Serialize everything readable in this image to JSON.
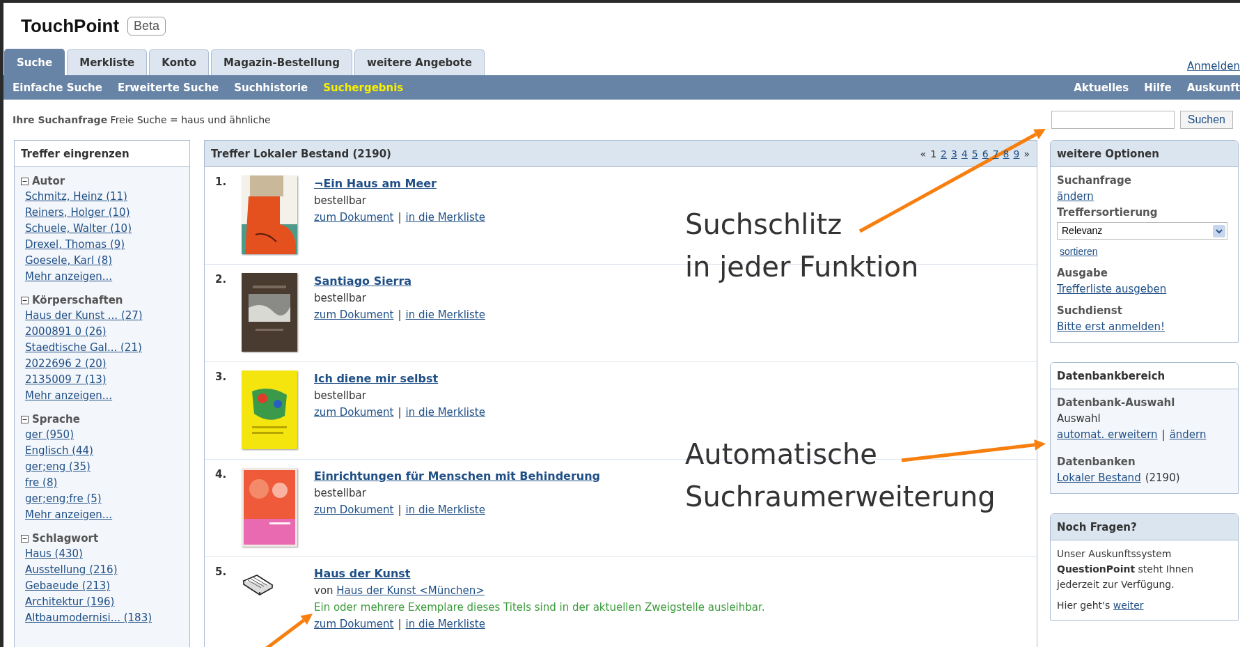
{
  "header": {
    "logo": "TouchPoint",
    "badge": "Beta"
  },
  "tabs": [
    {
      "label": "Suche",
      "selected": true
    },
    {
      "label": "Merkliste",
      "selected": false
    },
    {
      "label": "Konto",
      "selected": false
    },
    {
      "label": "Magazin-Bestellung",
      "selected": false
    },
    {
      "label": "weitere Angebote",
      "selected": false
    }
  ],
  "login_link": "Anmelden",
  "subnav": [
    {
      "label": "Einfache Suche",
      "selected": false
    },
    {
      "label": "Erweiterte Suche",
      "selected": false
    },
    {
      "label": "Suchhistorie",
      "selected": false
    },
    {
      "label": "Suchergebnis",
      "selected": true
    }
  ],
  "service_links": [
    "Aktuelles",
    "Hilfe",
    "Auskunft"
  ],
  "query": "**Ihre Suchanfrage** Freie Suche = haus und ähnliche",
  "search": {
    "button": "Suchen"
  },
  "facets": {
    "title": "Treffer eingrenzen",
    "groups": [
      {
        "label": "Autor",
        "expanded": true,
        "items": [
          "Schmitz, Heinz (11)",
          "Reiners, Holger (10)",
          "Schuele, Walter (10)",
          "Drexel, Thomas (9)",
          "Goesele, Karl (8)"
        ],
        "more": "Mehr anzeigen..."
      },
      {
        "label": "Körperschaften",
        "expanded": true,
        "items": [
          "Haus der Kunst ... (27)",
          "2000891 0 (26)",
          "Staedtische Gal... (21)",
          "2022696 2 (20)",
          "2135009 7 (13)"
        ],
        "more": "Mehr anzeigen..."
      },
      {
        "label": "Sprache",
        "expanded": true,
        "items": [
          "ger (950)",
          "Englisch (44)",
          "ger;eng (35)",
          "fre (8)",
          "ger;eng;fre (5)"
        ],
        "more": "Mehr anzeigen..."
      },
      {
        "label": "Schlagwort",
        "expanded": true,
        "items": [
          "Haus (430)",
          "Ausstellung (216)",
          "Gebaeude (213)",
          "Architektur (196)",
          "Altbaumodernisi... (183)"
        ]
      }
    ]
  },
  "results": {
    "title": "Treffer Lokaler Bestand (2190)",
    "pager": {
      "prev": "«",
      "next": "»",
      "pages": [
        {
          "label": "1",
          "selected": true
        },
        {
          "label": "2",
          "selected": false
        },
        {
          "label": "3",
          "selected": false
        },
        {
          "label": "4",
          "selected": false
        },
        {
          "label": "5",
          "selected": false
        },
        {
          "label": "6",
          "selected": false
        },
        {
          "label": "7",
          "selected": false
        },
        {
          "label": "8",
          "selected": false
        },
        {
          "label": "9",
          "selected": false
        }
      ]
    },
    "items": [
      {
        "number": "1.",
        "kind": "picture",
        "title": "¬Ein Haus am Meer",
        "status": "bestellbar",
        "links": [
          "zum Dokument",
          "in die Merkliste"
        ],
        "separator": "|"
      },
      {
        "number": "2.",
        "kind": "picture",
        "title": "Santiago Sierra",
        "status": "bestellbar",
        "links": [
          "zum Dokument",
          "in die Merkliste"
        ],
        "separator": "|"
      },
      {
        "number": "3.",
        "kind": "picture",
        "title": "Ich diene mir selbst",
        "status": "bestellbar",
        "links": [
          "zum Dokument",
          "in die Merkliste"
        ],
        "separator": "|"
      },
      {
        "number": "4.",
        "kind": "picture",
        "title": "Einrichtungen für Menschen mit Behinderung",
        "status": "bestellbar",
        "links": [
          "zum Dokument",
          "in die Merkliste"
        ],
        "separator": "|"
      },
      {
        "number": "5.",
        "kind": "icon",
        "title": "Haus der Kunst",
        "author_prefix": "von",
        "author": "Haus der Kunst <München>",
        "note": "Ein oder mehrere Exemplare dieses Titels sind in der aktuellen Zweigstelle ausleihbar.",
        "links": [
          "zum Dokument",
          "in die Merkliste"
        ],
        "separator": "|"
      }
    ]
  },
  "options": {
    "title": "weitere Optionen",
    "sections": [
      {
        "kind": "link",
        "label": "Suchanfrage",
        "link": "ändern"
      },
      {
        "kind": "select",
        "label": "Treffersortierung",
        "value": "Relevanz",
        "action": "sortieren"
      },
      {
        "kind": "link",
        "label": "Ausgabe",
        "link": "Trefferliste ausgeben"
      },
      {
        "kind": "link",
        "label": "Suchdienst",
        "link": "Bitte erst anmelden!"
      }
    ]
  },
  "database": {
    "title": "Datenbankbereich",
    "sections": [
      {
        "kind": "links",
        "label": "Datenbank-Auswahl",
        "value": "Auswahl",
        "links": [
          "automat. erweitern",
          "ändern"
        ],
        "separator": "|"
      },
      {
        "kind": "count",
        "label": "Datenbanken",
        "link": "Lokaler Bestand",
        "count": "(2190)"
      }
    ]
  },
  "help": {
    "title": "Noch Fragen?",
    "text": "Unser Auskunftssystem **QuestionPoint** steht Ihnen jederzeit zur Verfügung.",
    "more_prefix": "Hier geht's",
    "more_link": "weiter"
  },
  "annotations": [
    {
      "lines": [
        "Suchschlitz",
        "in jeder Funktion"
      ]
    },
    {
      "lines": [
        "Automatische",
        "Suchraumerweiterung"
      ]
    }
  ]
}
